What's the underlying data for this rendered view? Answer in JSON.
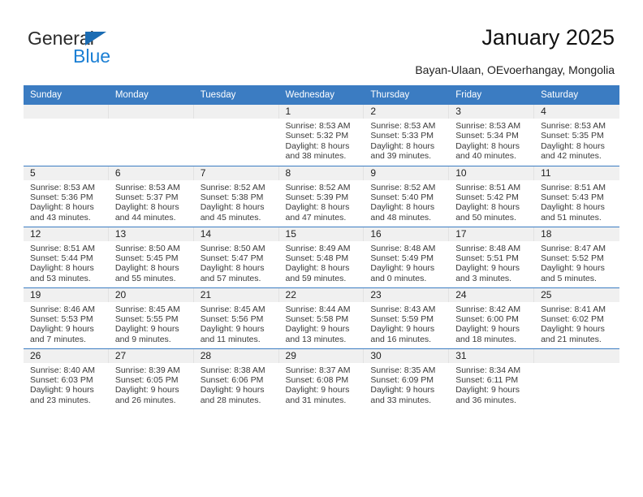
{
  "brand": {
    "name_part1": "General",
    "name_part2": "Blue",
    "color_dark": "#2b2b2b",
    "color_blue": "#1b7fd4",
    "triangle_color": "#1b6cb3"
  },
  "header": {
    "title": "January 2025",
    "subtitle": "Bayan-Ulaan, OEvoerhangay, Mongolia"
  },
  "theme": {
    "header_blue": "#3b7cc2",
    "daynum_band": "#f0f0f0",
    "text": "#222222"
  },
  "calendar": {
    "weekday_headers": [
      "Sunday",
      "Monday",
      "Tuesday",
      "Wednesday",
      "Thursday",
      "Friday",
      "Saturday"
    ],
    "weeks": [
      [
        {
          "day": "",
          "sunrise": "",
          "sunset": "",
          "daylight1": "",
          "daylight2": ""
        },
        {
          "day": "",
          "sunrise": "",
          "sunset": "",
          "daylight1": "",
          "daylight2": ""
        },
        {
          "day": "",
          "sunrise": "",
          "sunset": "",
          "daylight1": "",
          "daylight2": ""
        },
        {
          "day": "1",
          "sunrise": "Sunrise: 8:53 AM",
          "sunset": "Sunset: 5:32 PM",
          "daylight1": "Daylight: 8 hours",
          "daylight2": "and 38 minutes."
        },
        {
          "day": "2",
          "sunrise": "Sunrise: 8:53 AM",
          "sunset": "Sunset: 5:33 PM",
          "daylight1": "Daylight: 8 hours",
          "daylight2": "and 39 minutes."
        },
        {
          "day": "3",
          "sunrise": "Sunrise: 8:53 AM",
          "sunset": "Sunset: 5:34 PM",
          "daylight1": "Daylight: 8 hours",
          "daylight2": "and 40 minutes."
        },
        {
          "day": "4",
          "sunrise": "Sunrise: 8:53 AM",
          "sunset": "Sunset: 5:35 PM",
          "daylight1": "Daylight: 8 hours",
          "daylight2": "and 42 minutes."
        }
      ],
      [
        {
          "day": "5",
          "sunrise": "Sunrise: 8:53 AM",
          "sunset": "Sunset: 5:36 PM",
          "daylight1": "Daylight: 8 hours",
          "daylight2": "and 43 minutes."
        },
        {
          "day": "6",
          "sunrise": "Sunrise: 8:53 AM",
          "sunset": "Sunset: 5:37 PM",
          "daylight1": "Daylight: 8 hours",
          "daylight2": "and 44 minutes."
        },
        {
          "day": "7",
          "sunrise": "Sunrise: 8:52 AM",
          "sunset": "Sunset: 5:38 PM",
          "daylight1": "Daylight: 8 hours",
          "daylight2": "and 45 minutes."
        },
        {
          "day": "8",
          "sunrise": "Sunrise: 8:52 AM",
          "sunset": "Sunset: 5:39 PM",
          "daylight1": "Daylight: 8 hours",
          "daylight2": "and 47 minutes."
        },
        {
          "day": "9",
          "sunrise": "Sunrise: 8:52 AM",
          "sunset": "Sunset: 5:40 PM",
          "daylight1": "Daylight: 8 hours",
          "daylight2": "and 48 minutes."
        },
        {
          "day": "10",
          "sunrise": "Sunrise: 8:51 AM",
          "sunset": "Sunset: 5:42 PM",
          "daylight1": "Daylight: 8 hours",
          "daylight2": "and 50 minutes."
        },
        {
          "day": "11",
          "sunrise": "Sunrise: 8:51 AM",
          "sunset": "Sunset: 5:43 PM",
          "daylight1": "Daylight: 8 hours",
          "daylight2": "and 51 minutes."
        }
      ],
      [
        {
          "day": "12",
          "sunrise": "Sunrise: 8:51 AM",
          "sunset": "Sunset: 5:44 PM",
          "daylight1": "Daylight: 8 hours",
          "daylight2": "and 53 minutes."
        },
        {
          "day": "13",
          "sunrise": "Sunrise: 8:50 AM",
          "sunset": "Sunset: 5:45 PM",
          "daylight1": "Daylight: 8 hours",
          "daylight2": "and 55 minutes."
        },
        {
          "day": "14",
          "sunrise": "Sunrise: 8:50 AM",
          "sunset": "Sunset: 5:47 PM",
          "daylight1": "Daylight: 8 hours",
          "daylight2": "and 57 minutes."
        },
        {
          "day": "15",
          "sunrise": "Sunrise: 8:49 AM",
          "sunset": "Sunset: 5:48 PM",
          "daylight1": "Daylight: 8 hours",
          "daylight2": "and 59 minutes."
        },
        {
          "day": "16",
          "sunrise": "Sunrise: 8:48 AM",
          "sunset": "Sunset: 5:49 PM",
          "daylight1": "Daylight: 9 hours",
          "daylight2": "and 0 minutes."
        },
        {
          "day": "17",
          "sunrise": "Sunrise: 8:48 AM",
          "sunset": "Sunset: 5:51 PM",
          "daylight1": "Daylight: 9 hours",
          "daylight2": "and 3 minutes."
        },
        {
          "day": "18",
          "sunrise": "Sunrise: 8:47 AM",
          "sunset": "Sunset: 5:52 PM",
          "daylight1": "Daylight: 9 hours",
          "daylight2": "and 5 minutes."
        }
      ],
      [
        {
          "day": "19",
          "sunrise": "Sunrise: 8:46 AM",
          "sunset": "Sunset: 5:53 PM",
          "daylight1": "Daylight: 9 hours",
          "daylight2": "and 7 minutes."
        },
        {
          "day": "20",
          "sunrise": "Sunrise: 8:45 AM",
          "sunset": "Sunset: 5:55 PM",
          "daylight1": "Daylight: 9 hours",
          "daylight2": "and 9 minutes."
        },
        {
          "day": "21",
          "sunrise": "Sunrise: 8:45 AM",
          "sunset": "Sunset: 5:56 PM",
          "daylight1": "Daylight: 9 hours",
          "daylight2": "and 11 minutes."
        },
        {
          "day": "22",
          "sunrise": "Sunrise: 8:44 AM",
          "sunset": "Sunset: 5:58 PM",
          "daylight1": "Daylight: 9 hours",
          "daylight2": "and 13 minutes."
        },
        {
          "day": "23",
          "sunrise": "Sunrise: 8:43 AM",
          "sunset": "Sunset: 5:59 PM",
          "daylight1": "Daylight: 9 hours",
          "daylight2": "and 16 minutes."
        },
        {
          "day": "24",
          "sunrise": "Sunrise: 8:42 AM",
          "sunset": "Sunset: 6:00 PM",
          "daylight1": "Daylight: 9 hours",
          "daylight2": "and 18 minutes."
        },
        {
          "day": "25",
          "sunrise": "Sunrise: 8:41 AM",
          "sunset": "Sunset: 6:02 PM",
          "daylight1": "Daylight: 9 hours",
          "daylight2": "and 21 minutes."
        }
      ],
      [
        {
          "day": "26",
          "sunrise": "Sunrise: 8:40 AM",
          "sunset": "Sunset: 6:03 PM",
          "daylight1": "Daylight: 9 hours",
          "daylight2": "and 23 minutes."
        },
        {
          "day": "27",
          "sunrise": "Sunrise: 8:39 AM",
          "sunset": "Sunset: 6:05 PM",
          "daylight1": "Daylight: 9 hours",
          "daylight2": "and 26 minutes."
        },
        {
          "day": "28",
          "sunrise": "Sunrise: 8:38 AM",
          "sunset": "Sunset: 6:06 PM",
          "daylight1": "Daylight: 9 hours",
          "daylight2": "and 28 minutes."
        },
        {
          "day": "29",
          "sunrise": "Sunrise: 8:37 AM",
          "sunset": "Sunset: 6:08 PM",
          "daylight1": "Daylight: 9 hours",
          "daylight2": "and 31 minutes."
        },
        {
          "day": "30",
          "sunrise": "Sunrise: 8:35 AM",
          "sunset": "Sunset: 6:09 PM",
          "daylight1": "Daylight: 9 hours",
          "daylight2": "and 33 minutes."
        },
        {
          "day": "31",
          "sunrise": "Sunrise: 8:34 AM",
          "sunset": "Sunset: 6:11 PM",
          "daylight1": "Daylight: 9 hours",
          "daylight2": "and 36 minutes."
        },
        {
          "day": "",
          "sunrise": "",
          "sunset": "",
          "daylight1": "",
          "daylight2": ""
        }
      ]
    ]
  }
}
